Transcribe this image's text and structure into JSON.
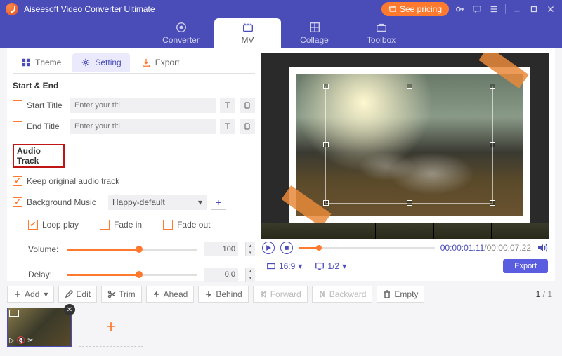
{
  "app_title": "Aiseesoft Video Converter Ultimate",
  "titlebar": {
    "see_pricing": "See pricing"
  },
  "nav": {
    "converter": "Converter",
    "mv": "MV",
    "collage": "Collage",
    "toolbox": "Toolbox"
  },
  "tabs": {
    "theme": "Theme",
    "setting": "Setting",
    "export": "Export"
  },
  "sections": {
    "start_end": "Start & End",
    "audio_track": "Audio Track"
  },
  "start_end": {
    "start_title_label": "Start Title",
    "end_title_label": "End Title",
    "placeholder": "Enter your titl"
  },
  "audio": {
    "keep_original": "Keep original audio track",
    "background_music": "Background Music",
    "bg_option": "Happy-default",
    "loop": "Loop play",
    "fade_in": "Fade in",
    "fade_out": "Fade out",
    "volume_label": "Volume:",
    "volume_value": "100",
    "delay_label": "Delay:",
    "delay_value": "0.0"
  },
  "player": {
    "ratio": "16:9",
    "screens": "1/2",
    "current_time": "00:00:01.11",
    "total_time": "00:00:07.22",
    "export": "Export"
  },
  "toolbar": {
    "add": "Add",
    "edit": "Edit",
    "trim": "Trim",
    "ahead": "Ahead",
    "behind": "Behind",
    "forward": "Forward",
    "backward": "Backward",
    "empty": "Empty"
  },
  "pager": {
    "current": "1",
    "sep": " / ",
    "total": "1"
  }
}
